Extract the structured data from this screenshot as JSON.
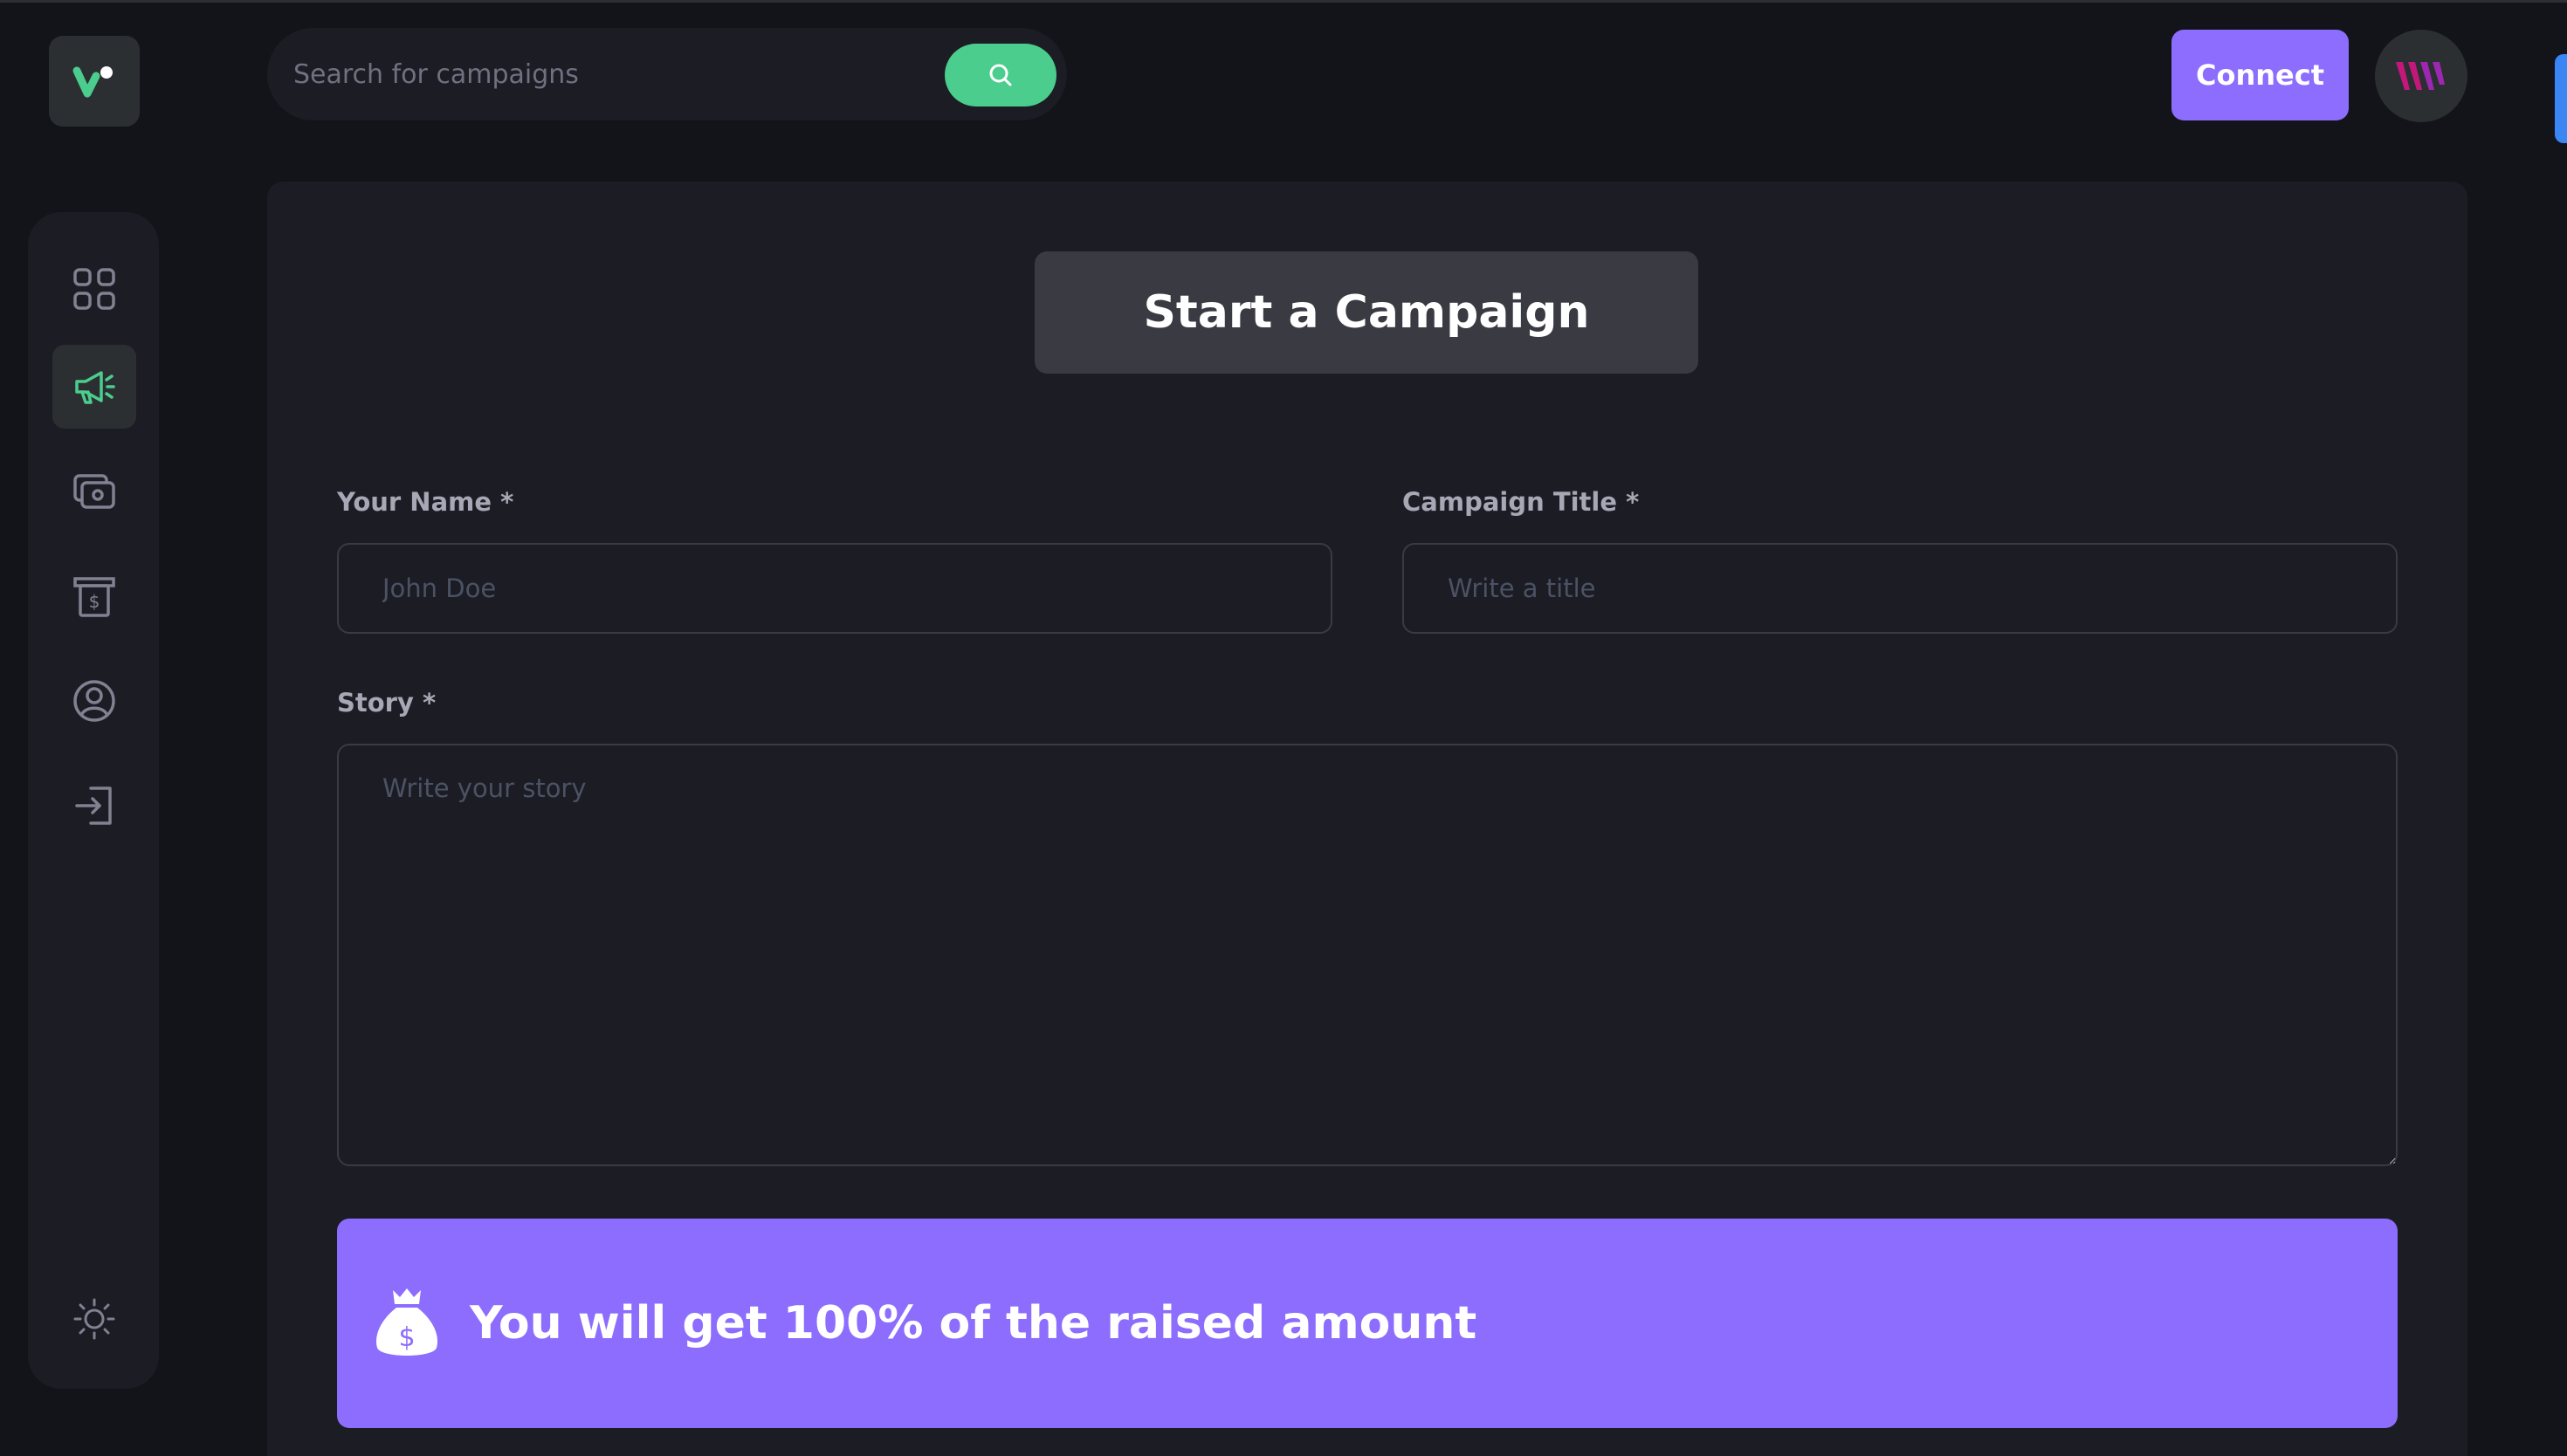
{
  "app": {
    "logo_icon": "logo-mark-icon",
    "accent_color": "#8c6dfd",
    "success_color": "#4acd8d"
  },
  "search": {
    "placeholder": "Search for campaigns",
    "value": "",
    "icon": "search-icon"
  },
  "header": {
    "connect_label": "Connect",
    "avatar_icon": "wallet-logo-icon"
  },
  "sidebar": {
    "items": [
      {
        "name": "dashboard",
        "icon": "grid-icon",
        "active": false
      },
      {
        "name": "campaign",
        "icon": "megaphone-icon",
        "active": true
      },
      {
        "name": "payment",
        "icon": "payment-icon",
        "active": false
      },
      {
        "name": "withdraw",
        "icon": "withdraw-icon",
        "active": false
      },
      {
        "name": "profile",
        "icon": "profile-icon",
        "active": false
      },
      {
        "name": "logout",
        "icon": "logout-icon",
        "active": false
      }
    ],
    "theme_icon": "sun-icon"
  },
  "form": {
    "title": "Start a Campaign",
    "name_label": "Your Name *",
    "name_placeholder": "John Doe",
    "title_label": "Campaign Title *",
    "title_placeholder": "Write a title",
    "story_label": "Story *",
    "story_placeholder": "Write your story",
    "banner_text": "You will get 100% of the raised amount",
    "banner_icon": "money-bag-icon"
  }
}
